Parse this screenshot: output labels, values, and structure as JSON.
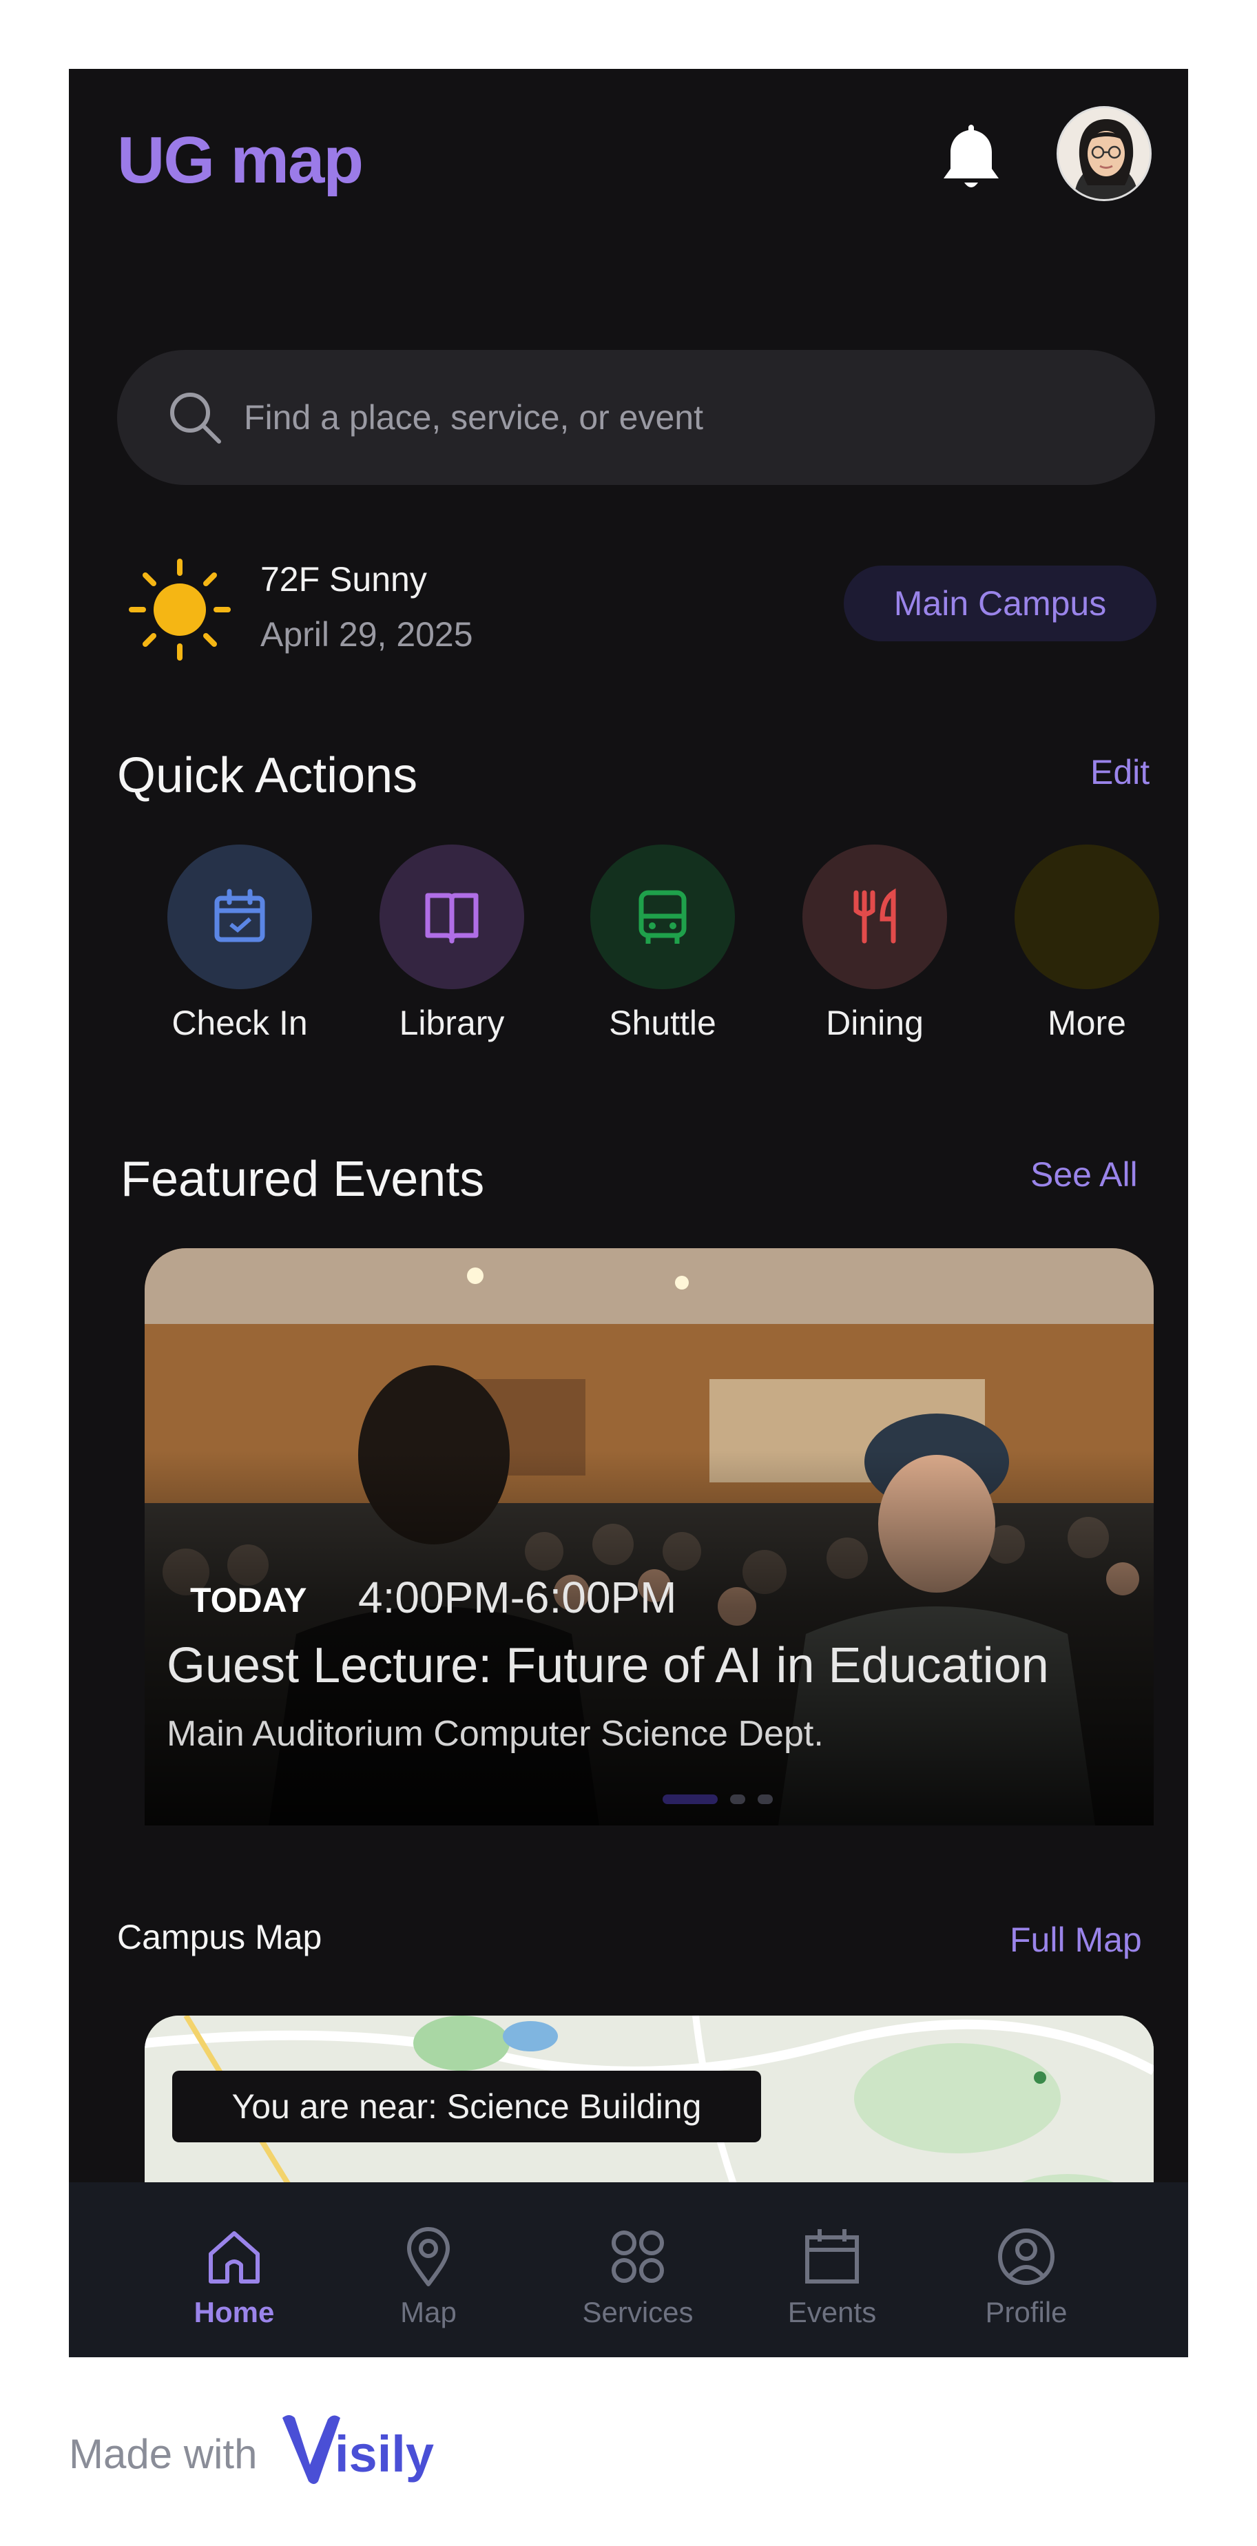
{
  "header": {
    "brand": "UG map",
    "notifications_icon": "bell-icon"
  },
  "search": {
    "placeholder": "Find a place, service, or event",
    "icon": "search-icon"
  },
  "weather": {
    "temperature": "72F Sunny",
    "date": "April 29, 2025",
    "icon": "sun-icon"
  },
  "campus": {
    "label": "Main Campus"
  },
  "quick_actions": {
    "title": "Quick Actions",
    "edit_label": "Edit",
    "items": [
      {
        "label": "Check In",
        "icon": "calendar-check-icon",
        "bg": "#263249",
        "color": "#5b86e5"
      },
      {
        "label": "Library",
        "icon": "book-icon",
        "bg": "#342541",
        "color": "#b06ee6"
      },
      {
        "label": "Shuttle",
        "icon": "bus-icon",
        "bg": "#13301e",
        "color": "#1fa14b"
      },
      {
        "label": "Dining",
        "icon": "utensils-icon",
        "bg": "#3a2426",
        "color": "#e24b4b"
      },
      {
        "label": "More",
        "icon": "more-icon",
        "bg": "#2a2508",
        "color": "#2a2508"
      }
    ]
  },
  "featured_events": {
    "title": "Featured Events",
    "see_all_label": "See All",
    "event": {
      "day": "TODAY",
      "time": "4:00PM-6:00PM",
      "title": "Guest Lecture: Future of AI in Education",
      "location": "Main Auditorium Computer Science Dept."
    },
    "carousel_pages": 3,
    "carousel_active": 1
  },
  "campus_map": {
    "title": "Campus Map",
    "full_map_label": "Full Map",
    "near_text": "You are near: Science Building"
  },
  "tabbar": {
    "items": [
      {
        "label": "Home",
        "icon": "home-icon",
        "active": true
      },
      {
        "label": "Map",
        "icon": "map-pin-icon",
        "active": false
      },
      {
        "label": "Services",
        "icon": "grid-icon",
        "active": false
      },
      {
        "label": "Events",
        "icon": "calendar-icon",
        "active": false
      },
      {
        "label": "Profile",
        "icon": "profile-icon",
        "active": false
      }
    ]
  },
  "footer": {
    "made_with": "Made with",
    "logo_text": "Visily"
  },
  "colors": {
    "accent": "#9a84ea",
    "background": "#121113",
    "card": "#242327"
  }
}
